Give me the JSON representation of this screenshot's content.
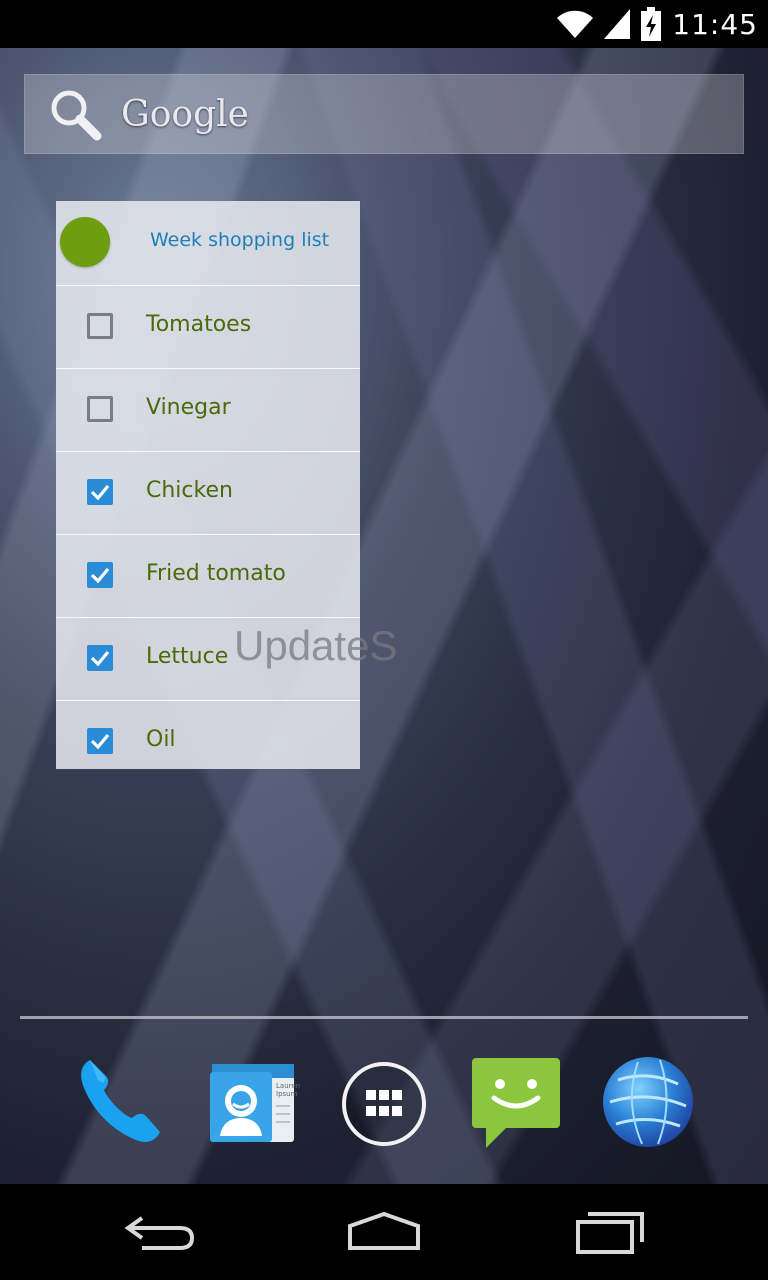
{
  "status_bar": {
    "time": "11:45",
    "icons": [
      "wifi-icon",
      "signal-icon",
      "battery-charging-icon"
    ]
  },
  "search_widget": {
    "label": "Google",
    "icon": "search-icon"
  },
  "shopping_widget": {
    "title": "Week shopping list",
    "accent_color": "#6d9e0f",
    "items": [
      {
        "label": "Tomatoes",
        "checked": false
      },
      {
        "label": "Vinegar",
        "checked": false
      },
      {
        "label": "Chicken",
        "checked": true
      },
      {
        "label": "Fried tomato",
        "checked": true
      },
      {
        "label": "Lettuce",
        "checked": true
      },
      {
        "label": "Oil",
        "checked": true
      }
    ]
  },
  "watermark": "UpdateS",
  "dock": {
    "apps": [
      "phone-icon",
      "contacts-icon",
      "app-drawer-icon",
      "messaging-icon",
      "browser-icon"
    ],
    "contacts_card_text": "Lauren Ipsum"
  },
  "nav_bar": {
    "buttons": [
      "back-icon",
      "home-icon",
      "recents-icon"
    ]
  }
}
